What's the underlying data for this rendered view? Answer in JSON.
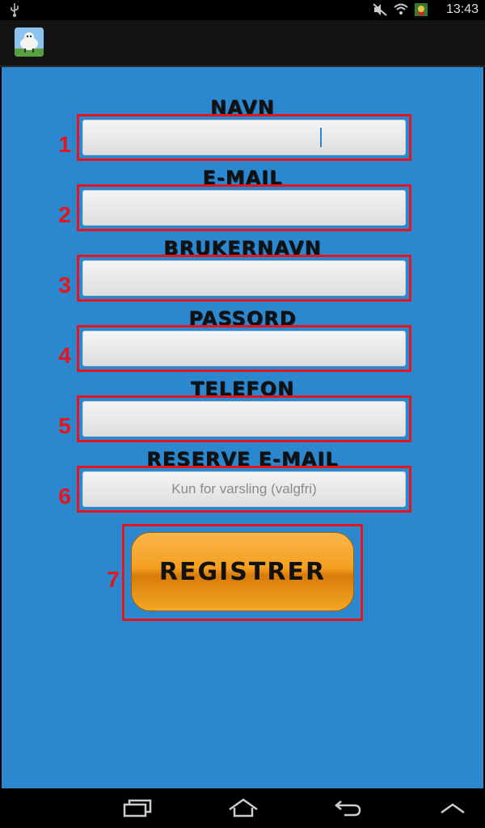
{
  "statusbar": {
    "time": "13:43"
  },
  "form": {
    "fields": [
      {
        "number": "1",
        "label": "NAVN",
        "value": "",
        "placeholder": ""
      },
      {
        "number": "2",
        "label": "E-MAIL",
        "value": "",
        "placeholder": ""
      },
      {
        "number": "3",
        "label": "BRUKERNAVN",
        "value": "",
        "placeholder": ""
      },
      {
        "number": "4",
        "label": "PASSORD",
        "value": "",
        "placeholder": ""
      },
      {
        "number": "5",
        "label": "TELEFON",
        "value": "",
        "placeholder": ""
      },
      {
        "number": "6",
        "label": "RESERVE E-MAIL",
        "value": "",
        "placeholder": "Kun for varsling (valgfri)"
      }
    ],
    "submit": {
      "number": "7",
      "label": "REGISTRER"
    }
  },
  "colors": {
    "background": "#2b88ce",
    "annotation": "#e8141c",
    "button": "#f5a020"
  }
}
